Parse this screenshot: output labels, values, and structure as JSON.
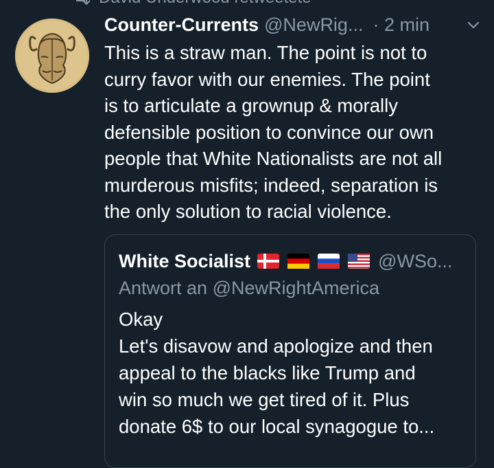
{
  "retweet": {
    "text": "David Underwood retweetete",
    "icon": "retweet-icon"
  },
  "tweet": {
    "avatar_icon": "janus-head-avatar",
    "display_name": "Counter-Currents",
    "handle": "@NewRig...",
    "time": "· 2 min",
    "menu_icon": "chevron-down-icon",
    "text": "This is a straw man. The point is not to\ncurry favor with our enemies. The point\nis to articulate a grownup & morally\ndefensible position to convince our own\npeople that White Nationalists are not all\nmurderous misfits; indeed, separation is\nthe only solution to racial violence."
  },
  "quote": {
    "display_name": "White Socialist",
    "flags": [
      "flag-denmark-icon",
      "flag-germany-icon",
      "flag-russia-icon",
      "flag-usa-icon"
    ],
    "handle": "@WSo...",
    "reply_to": "Antwort an @NewRightAmerica",
    "text": "Okay\nLet's disavow and apologize and then\nappeal to the blacks like Trump and\nwin so much we get tired of it. Plus\ndonate 6$ to our local synagogue to..."
  },
  "colors": {
    "background": "#15202b",
    "primary_text": "#ffffff",
    "secondary_text": "#8899a6",
    "border": "#38444d"
  }
}
